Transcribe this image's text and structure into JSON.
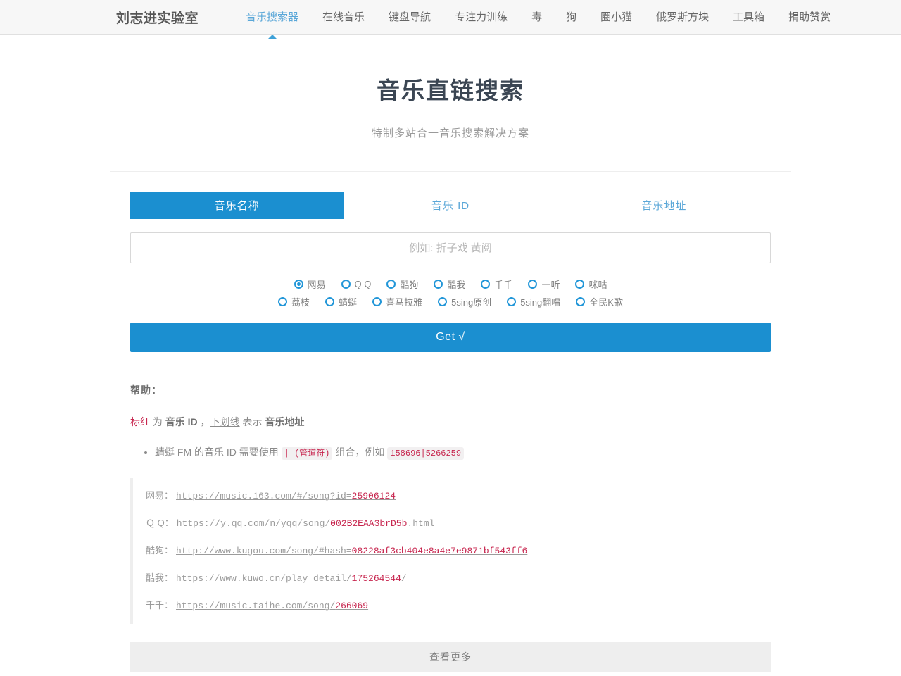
{
  "header": {
    "brand": "刘志进实验室",
    "nav_items": [
      {
        "label": "音乐搜索器",
        "active": true
      },
      {
        "label": "在线音乐",
        "active": false
      },
      {
        "label": "键盘导航",
        "active": false
      },
      {
        "label": "专注力训练",
        "active": false
      },
      {
        "label": "毒",
        "active": false
      },
      {
        "label": "狗",
        "active": false
      },
      {
        "label": "圈小猫",
        "active": false
      },
      {
        "label": "俄罗斯方块",
        "active": false
      },
      {
        "label": "工具箱",
        "active": false
      },
      {
        "label": "捐助赞赏",
        "active": false
      }
    ]
  },
  "hero": {
    "title": "音乐直链搜索",
    "subtitle": "特制多站合一音乐搜索解决方案"
  },
  "tabs": [
    {
      "label": "音乐名称",
      "active": true
    },
    {
      "label": "音乐 ID",
      "active": false
    },
    {
      "label": "音乐地址",
      "active": false
    }
  ],
  "search": {
    "value": "",
    "placeholder": "例如: 折子戏 黄阅"
  },
  "sources": {
    "row1": [
      {
        "label": "网易",
        "selected": true
      },
      {
        "label": "Q Q",
        "selected": false
      },
      {
        "label": "酷狗",
        "selected": false
      },
      {
        "label": "酷我",
        "selected": false
      },
      {
        "label": "千千",
        "selected": false
      },
      {
        "label": "一听",
        "selected": false
      },
      {
        "label": "咪咕",
        "selected": false
      }
    ],
    "row2": [
      {
        "label": "荔枝",
        "selected": false
      },
      {
        "label": "蜻蜓",
        "selected": false
      },
      {
        "label": "喜马拉雅",
        "selected": false
      },
      {
        "label": "5sing原创",
        "selected": false
      },
      {
        "label": "5sing翻唱",
        "selected": false
      },
      {
        "label": "全民K歌",
        "selected": false
      }
    ]
  },
  "get_button": {
    "label": "Get √"
  },
  "help": {
    "title": "帮助：",
    "legend": {
      "red_word": "标红",
      "mid1": " 为 ",
      "bold1": "音乐 ID",
      "mid2": " ，",
      "underline_word": "下划线",
      "mid3": " 表示 ",
      "bold2": "音乐地址"
    },
    "items": [
      {
        "text_before": "蜻蜓 FM 的音乐 ID 需要使用 ",
        "code1": "| (管道符)",
        "text_mid": " 组合，例如 ",
        "code2": "158696|5266259"
      }
    ]
  },
  "examples": [
    {
      "site": "网易：",
      "base": "https://music.163.com/#/song?id=",
      "id": "25906124",
      "tail": ""
    },
    {
      "site": "Ｑ Q：",
      "base": "https://y.qq.com/n/yqq/song/",
      "id": "002B2EAA3brD5b",
      "tail": ".html"
    },
    {
      "site": "酷狗：",
      "base": "http://www.kugou.com/song/#hash=",
      "id": "08228af3cb404e8a4e7e9871bf543ff6",
      "tail": ""
    },
    {
      "site": "酷我：",
      "base": "https://www.kuwo.cn/play_detail/",
      "id": "175264544",
      "tail": "/"
    },
    {
      "site": "千千：",
      "base": "https://music.taihe.com/song/",
      "id": "266069",
      "tail": ""
    }
  ],
  "more_button": {
    "label": "查看更多"
  },
  "colors": {
    "accent_blue": "#1b8fd0",
    "nav_active": "#5aa7d8",
    "code_red": "#c7254e",
    "header_bg": "#f7f7f7"
  }
}
